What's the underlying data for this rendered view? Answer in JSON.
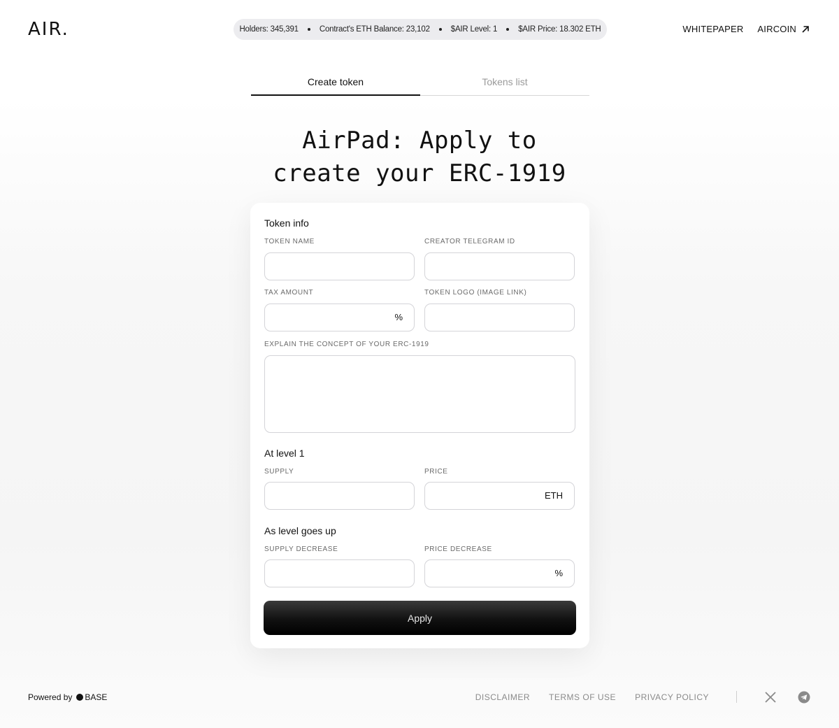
{
  "header": {
    "logo": "AIR.",
    "stats": {
      "holders": "Holders: 345,391",
      "balance": "Contract's ETH Balance: 23,102",
      "level": "$AIR Level: 1",
      "price": "$AIR Price: 18.302 ETH"
    },
    "nav": {
      "whitepaper": "WHITEPAPER",
      "aircoin": "AIRCOIN"
    }
  },
  "tabs": [
    {
      "label": "Create token",
      "active": true
    },
    {
      "label": "Tokens list",
      "active": false
    }
  ],
  "title": {
    "line1": "AirPad: Apply to",
    "line2": "create your ERC-1919"
  },
  "form": {
    "token_info": "Token info",
    "token_name_label": "TOKEN NAME",
    "token_name_value": "",
    "telegram_label": "CREATOR TELEGRAM ID",
    "telegram_value": "",
    "tax_label": "TAX AMOUNT",
    "tax_value": "",
    "tax_suffix": "%",
    "logo_label": "TOKEN LOGO (IMAGE LINK)",
    "logo_value": "",
    "concept_label": "EXPLAIN THE CONCEPT OF YOUR ERC-1919",
    "concept_value": "",
    "level1_heading": "At level 1",
    "supply_label": "SUPPLY",
    "supply_value": "",
    "price_label": "PRICE",
    "price_value": "",
    "price_suffix": "ETH",
    "level_up_heading": "As level goes up",
    "supply_decrease_label": "SUPPLY DECREASE",
    "supply_decrease_value": "",
    "price_decrease_label": "PRICE DECREASE",
    "price_decrease_value": "",
    "price_decrease_suffix": "%",
    "apply_label": "Apply"
  },
  "footer": {
    "powered_by": "Powered by",
    "base": "BASE",
    "links": {
      "disclaimer": "DISCLAIMER",
      "terms": "TERMS OF USE",
      "privacy": "PRIVACY POLICY"
    },
    "icons": [
      "x-icon",
      "telegram-icon"
    ]
  },
  "colors": {
    "accent": "#111111",
    "stats_bg": "#ececef",
    "muted": "#8a8a8a"
  }
}
